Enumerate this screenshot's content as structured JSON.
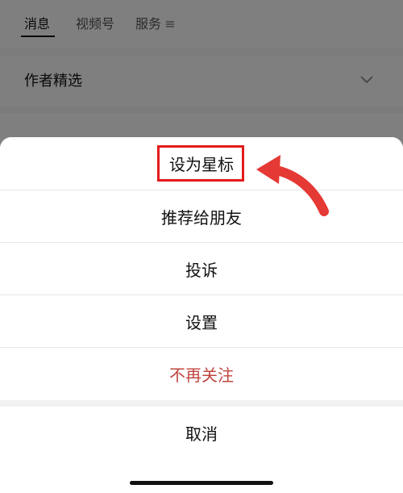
{
  "background": {
    "tabs": {
      "messages": "消息",
      "channels": "视频号",
      "services": "服务"
    },
    "author_section": {
      "label": "作者精选"
    }
  },
  "action_sheet": {
    "options": [
      {
        "label": "设为星标"
      },
      {
        "label": "推荐给朋友"
      },
      {
        "label": "投诉"
      },
      {
        "label": "设置"
      },
      {
        "label": "不再关注",
        "color": "#c0453e"
      }
    ],
    "cancel_label": "取消"
  },
  "annotation": {
    "highlight_color": "#e31b1b",
    "arrow_color": "#e53935"
  },
  "icons": [
    "menu-icon",
    "chevron-down-icon"
  ]
}
